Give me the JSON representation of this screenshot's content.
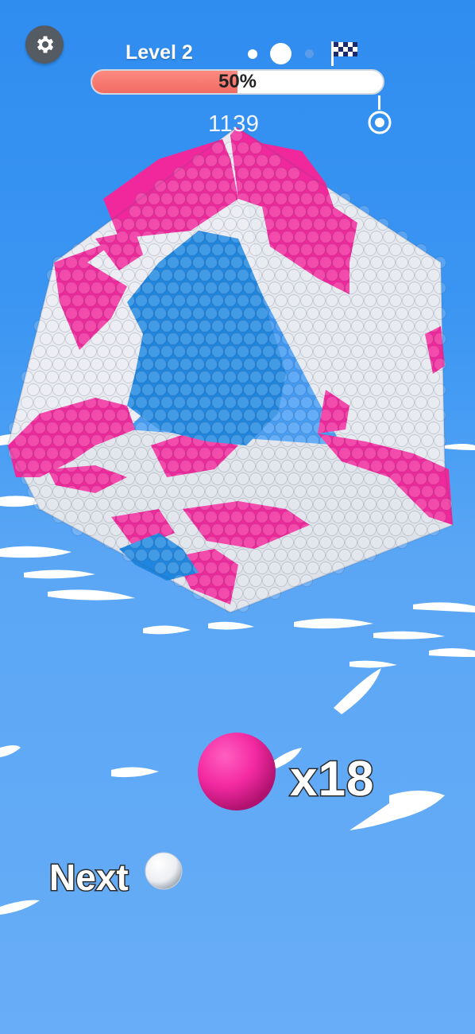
{
  "hud": {
    "level_label": "Level 2",
    "progress_percent": 50,
    "progress_label": "50%",
    "score": "1139",
    "stage_dots": [
      "completed",
      "current",
      "upcoming"
    ]
  },
  "launcher": {
    "current_ball_color": "#ff2fa6",
    "ball_count_label": "x18",
    "next_label": "Next",
    "next_ball_color": "#ffffff"
  },
  "colors": {
    "pink": "#f0289b",
    "blue": "#1f86e0",
    "white": "#eef0f4",
    "water": "#5aa6f5",
    "progress_fill": "#f06b63"
  },
  "icons": {
    "settings": "gear-icon",
    "finish": "checkered-flag-icon",
    "goal": "target-icon"
  }
}
